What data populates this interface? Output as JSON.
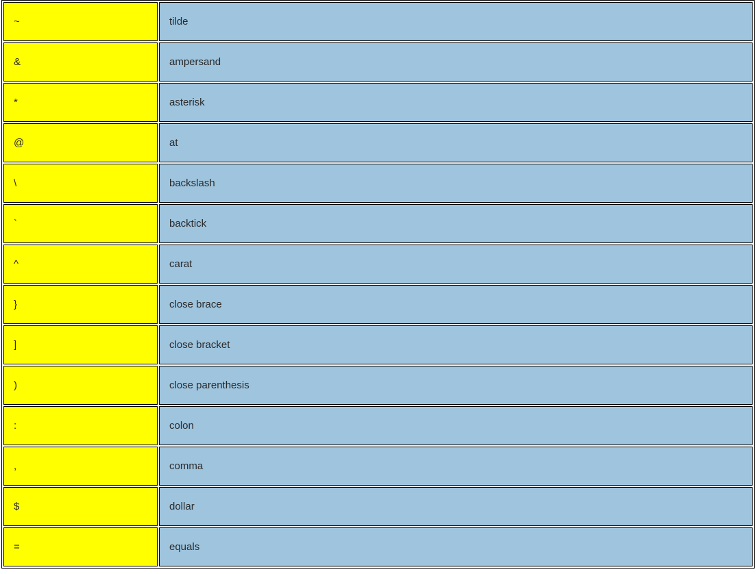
{
  "rows": [
    {
      "symbol": "~",
      "name": "tilde"
    },
    {
      "symbol": "&",
      "name": "ampersand"
    },
    {
      "symbol": "*",
      "name": "asterisk"
    },
    {
      "symbol": "@",
      "name": "at"
    },
    {
      "symbol": "\\",
      "name": "backslash"
    },
    {
      "symbol": "`",
      "name": "backtick"
    },
    {
      "symbol": "^",
      "name": "carat"
    },
    {
      "symbol": "}",
      "name": "close brace"
    },
    {
      "symbol": "]",
      "name": "close bracket"
    },
    {
      "symbol": ")",
      "name": "close parenthesis"
    },
    {
      "symbol": ":",
      "name": "colon"
    },
    {
      "symbol": ",",
      "name": "comma"
    },
    {
      "symbol": "$",
      "name": "dollar"
    },
    {
      "symbol": "=",
      "name": "equals"
    }
  ]
}
